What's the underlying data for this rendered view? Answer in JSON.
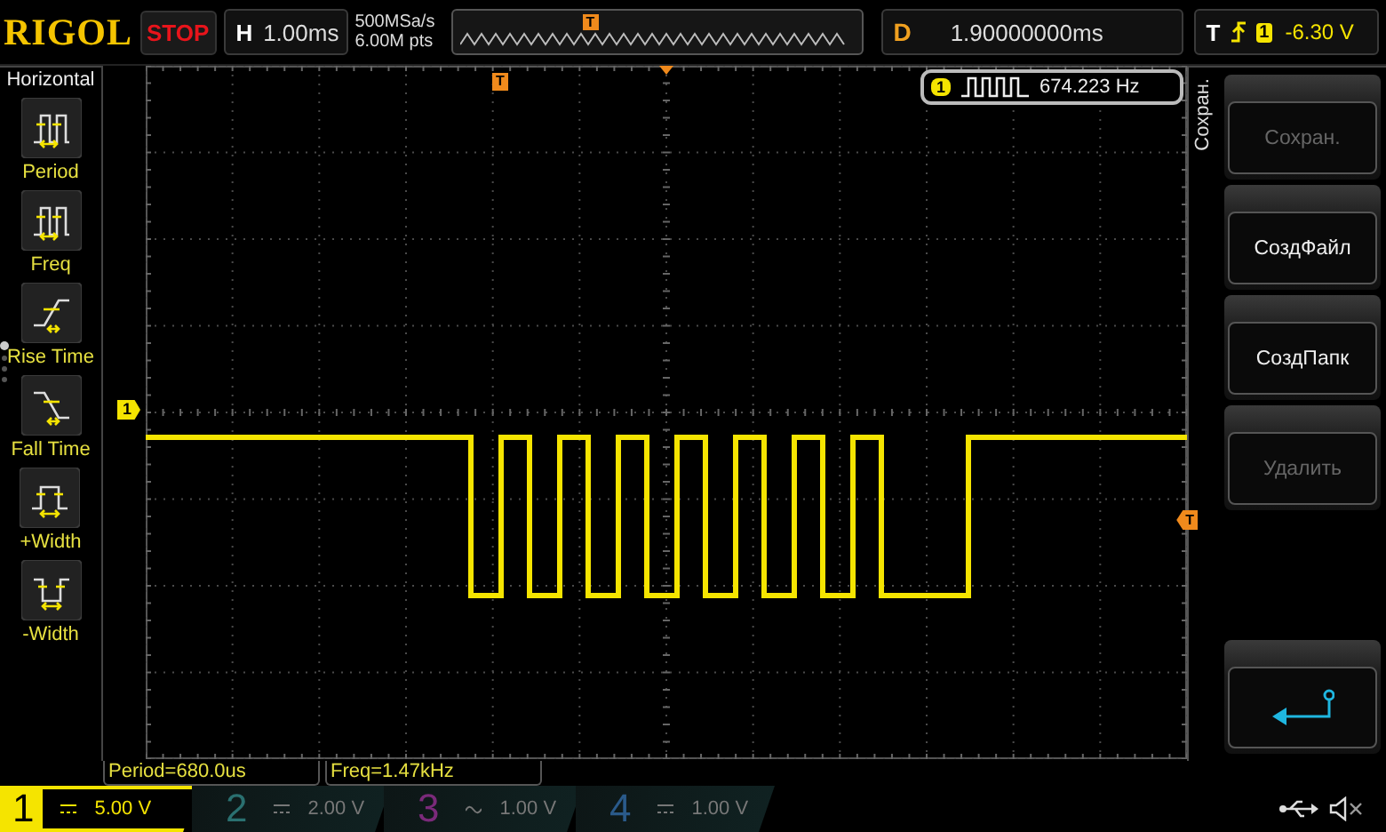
{
  "top_bar": {
    "logo": "RIGOL",
    "run_status": "STOP",
    "timebase": {
      "label": "H",
      "value": "1.00ms"
    },
    "sample_rate": "500MSa/s",
    "memory_depth": "6.00M pts",
    "memory_trigger_marker": "T",
    "delay": {
      "label": "D",
      "value": "1.90000000ms"
    },
    "trigger": {
      "label": "T",
      "source": "1",
      "level": "-6.30 V"
    }
  },
  "left_menu": {
    "title": "Horizontal",
    "items": [
      {
        "kind": "period",
        "label": "Period"
      },
      {
        "kind": "freq",
        "label": "Freq"
      },
      {
        "kind": "rise",
        "label": "Rise Time"
      },
      {
        "kind": "fall",
        "label": "Fall Time"
      },
      {
        "kind": "pwidth",
        "label": "+Width"
      },
      {
        "kind": "nwidth",
        "label": "-Width"
      }
    ],
    "page_dots": [
      {
        "selected": true
      },
      {
        "selected": false
      },
      {
        "selected": false
      },
      {
        "selected": false
      }
    ]
  },
  "screen": {
    "channel_marker": "1",
    "trigger_position_marker": "T",
    "trigger_level_marker": "T",
    "counter": {
      "channel": "1",
      "value": "674.223 Hz"
    }
  },
  "measurements": [
    "Period=680.0us",
    "Freq=1.47kHz"
  ],
  "right_menu": {
    "title": "Сохран.",
    "softkeys": [
      {
        "kind": "text",
        "label": "Сохран.",
        "disabled": true
      },
      {
        "kind": "text",
        "label": "СоздФайл",
        "disabled": false
      },
      {
        "kind": "text",
        "label": "СоздПапк",
        "disabled": false
      },
      {
        "kind": "text",
        "label": "Удалить",
        "disabled": true
      },
      {
        "kind": "return"
      }
    ]
  },
  "channels": [
    {
      "number": "1",
      "kind": "dc",
      "scale": "5.00 V",
      "color": "#f5e400",
      "selected": true
    },
    {
      "number": "2",
      "kind": "dc",
      "scale": "2.00 V",
      "color": "#2a7070",
      "selected": false
    },
    {
      "number": "3",
      "kind": "ac",
      "scale": "1.00 V",
      "color": "#7a2a7a",
      "selected": false
    },
    {
      "number": "4",
      "kind": "dc",
      "scale": "1.00 V",
      "color": "#2a5a8a",
      "selected": false
    }
  ]
}
